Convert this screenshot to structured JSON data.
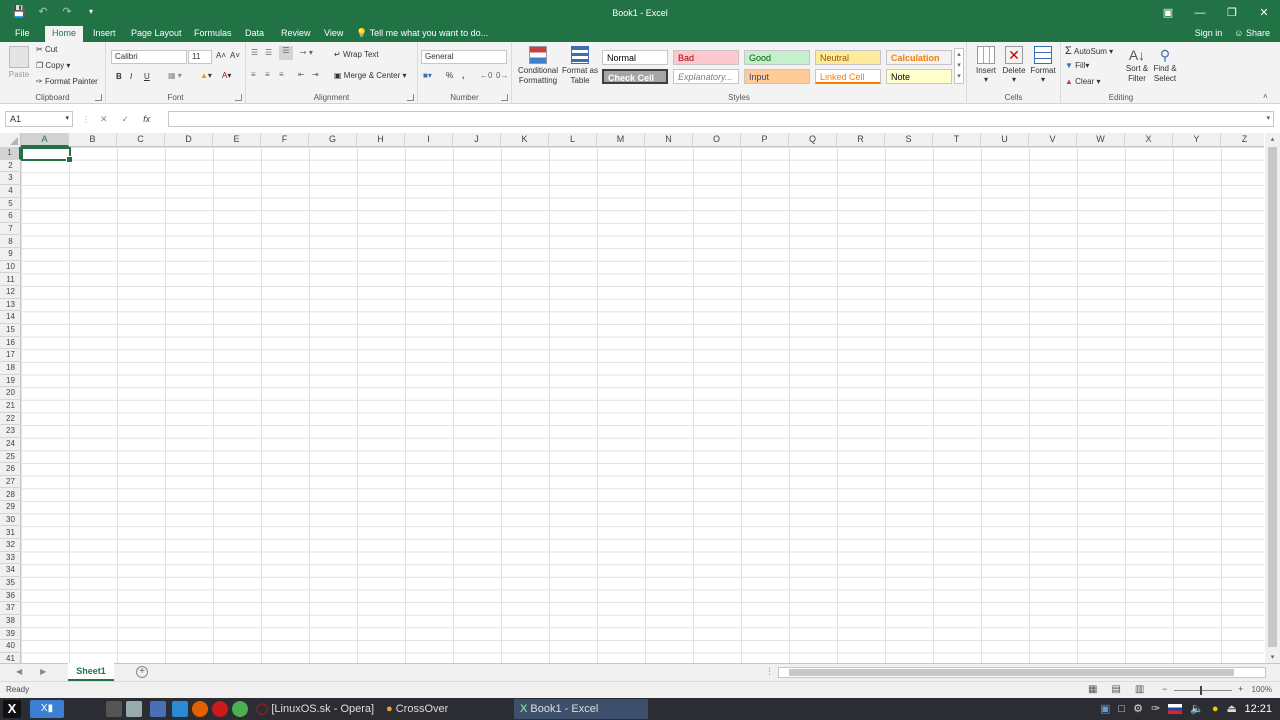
{
  "titlebar": {
    "title": "Book1 - Excel",
    "save_icon": "save-icon",
    "undo_icon": "undo-icon",
    "redo_icon": "redo-icon",
    "customize_icon": "customize-qat-icon"
  },
  "tabs": [
    {
      "label": "File"
    },
    {
      "label": "Home"
    },
    {
      "label": "Insert"
    },
    {
      "label": "Page Layout"
    },
    {
      "label": "Formulas"
    },
    {
      "label": "Data"
    },
    {
      "label": "Review"
    },
    {
      "label": "View"
    }
  ],
  "tellme": "Tell me what you want to do...",
  "account": {
    "signin": "Sign in",
    "share": "Share"
  },
  "ribbon": {
    "clipboard": {
      "label": "Clipboard",
      "paste": "Paste",
      "cut": "Cut",
      "copy": "Copy",
      "format_painter": "Format Painter"
    },
    "font": {
      "label": "Font",
      "font_name": "Calibri",
      "font_size": "11",
      "bold": "B",
      "italic": "I",
      "underline": "U"
    },
    "alignment": {
      "label": "Alignment",
      "wrap_text": "Wrap Text",
      "merge_center": "Merge & Center"
    },
    "number": {
      "label": "Number",
      "format": "General",
      "percent": "%",
      "comma": ","
    },
    "styles": {
      "label": "Styles",
      "conditional_formatting": "Conditional Formatting",
      "format_as_table": "Format as Table",
      "gallery": [
        {
          "name": "Normal",
          "bg": "#ffffff",
          "fg": "#000000"
        },
        {
          "name": "Bad",
          "bg": "#ffc7ce",
          "fg": "#9c0006"
        },
        {
          "name": "Good",
          "bg": "#c6efce",
          "fg": "#006100"
        },
        {
          "name": "Neutral",
          "bg": "#ffeb9c",
          "fg": "#9c5700"
        },
        {
          "name": "Calculation",
          "bg": "#f2f2f2",
          "fg": "#fa7d00"
        },
        {
          "name": "Check Cell",
          "bg": "#a5a5a5",
          "fg": "#ffffff"
        },
        {
          "name": "Explanatory...",
          "bg": "#ffffff",
          "fg": "#7f7f7f"
        },
        {
          "name": "Input",
          "bg": "#ffcc99",
          "fg": "#3f3f76"
        },
        {
          "name": "Linked Cell",
          "bg": "#ffffff",
          "fg": "#fa7d00"
        },
        {
          "name": "Note",
          "bg": "#ffffcc",
          "fg": "#000000"
        }
      ]
    },
    "cells": {
      "label": "Cells",
      "insert": "Insert",
      "delete": "Delete",
      "format": "Format"
    },
    "editing": {
      "label": "Editing",
      "autosum": "AutoSum",
      "fill": "Fill",
      "clear": "Clear",
      "sort_filter": "Sort & Filter",
      "find_select": "Find & Select"
    }
  },
  "formula_bar": {
    "namebox": "A1",
    "fx": "fx",
    "value": ""
  },
  "grid": {
    "columns": [
      "A",
      "B",
      "C",
      "D",
      "E",
      "F",
      "G",
      "H",
      "I",
      "J",
      "K",
      "L",
      "M",
      "N",
      "O",
      "P",
      "Q",
      "R",
      "S",
      "T",
      "U",
      "V",
      "W",
      "X",
      "Y",
      "Z"
    ],
    "rows": [
      "1",
      "2",
      "3",
      "4",
      "5",
      "6",
      "7",
      "8",
      "9",
      "10",
      "11",
      "12",
      "13",
      "14",
      "15",
      "16",
      "17",
      "18",
      "19",
      "20",
      "21",
      "22",
      "23",
      "24",
      "25",
      "26",
      "27",
      "28",
      "29",
      "30",
      "31",
      "32",
      "33",
      "34",
      "35",
      "36",
      "37",
      "38",
      "39",
      "40",
      "41"
    ],
    "active_cell": "A1"
  },
  "sheets": [
    {
      "name": "Sheet1"
    }
  ],
  "status": {
    "mode": "Ready",
    "zoom": "100%"
  },
  "taskbar": {
    "tasks": [
      {
        "label": "[LinuxOS.sk - Opera]"
      },
      {
        "label": "CrossOver"
      },
      {
        "label": "Book1 - Excel"
      }
    ],
    "clock": "12:21"
  },
  "colors": {
    "accent": "#217346",
    "taskbar": "#2b2d33"
  }
}
